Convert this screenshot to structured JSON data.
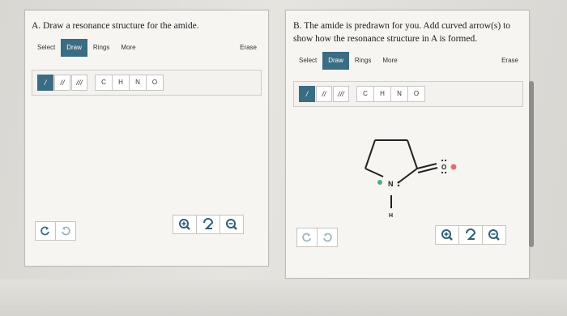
{
  "panel_a": {
    "question": "A. Draw a resonance structure for the amide.",
    "toolbar": {
      "select": "Select",
      "draw": "Draw",
      "rings": "Rings",
      "more": "More",
      "erase": "Erase"
    },
    "bonds": [
      "/",
      "//",
      "///"
    ],
    "atoms": [
      "C",
      "H",
      "N",
      "O"
    ]
  },
  "panel_b": {
    "question": "B. The amide is predrawn for you. Add curved arrow(s) to show how the resonance structure in A is formed.",
    "toolbar": {
      "select": "Select",
      "draw": "Draw",
      "rings": "Rings",
      "more": "More",
      "erase": "Erase"
    },
    "bonds": [
      "/",
      "//",
      "///"
    ],
    "atoms": [
      "C",
      "H",
      "N",
      "O"
    ],
    "molecule": {
      "n_label": "N",
      "h_label": "H",
      "o_label": "O"
    }
  },
  "colors": {
    "accent": "#3a6c84",
    "panel": "#f6f5f2"
  }
}
